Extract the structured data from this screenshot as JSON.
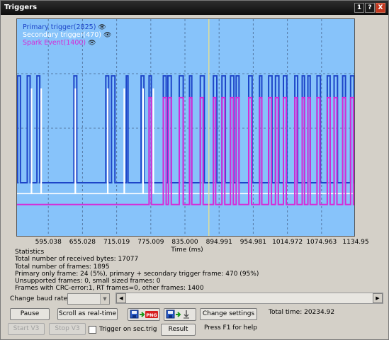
{
  "window": {
    "title": "Triggers",
    "buttons": [
      "1",
      "?",
      "X"
    ]
  },
  "chart_data": {
    "type": "line",
    "xlabel": "Time (ms)",
    "x_ticks": [
      "595.038",
      "655.028",
      "715.019",
      "775.009",
      "835.000",
      "894.991",
      "954.981",
      "1014.972",
      "1074.963",
      "1134.95"
    ],
    "x_tick_values": [
      595.038,
      655.028,
      715.019,
      775.009,
      835.0,
      894.991,
      954.981,
      1014.972,
      1074.963,
      1134.95
    ],
    "xlim": [
      540.0,
      1134.95
    ],
    "cursor_x": 877.0,
    "grid": true,
    "legend_placement": "top-left",
    "series": [
      {
        "name": "Primary trigger(2825)",
        "color": "#1d45c8",
        "baseline": 0.25,
        "high": 0.74,
        "pulses": [
          [
            541,
            546
          ],
          [
            558,
            563
          ],
          [
            575,
            580
          ],
          [
            640,
            645
          ],
          [
            696,
            701
          ],
          [
            706,
            712
          ],
          [
            732,
            735
          ],
          [
            758,
            763
          ],
          [
            772,
            776
          ],
          [
            797,
            802
          ],
          [
            805,
            811
          ],
          [
            825,
            832
          ],
          [
            843,
            847
          ],
          [
            862,
            869
          ],
          [
            885,
            891
          ],
          [
            900,
            906
          ],
          [
            915,
            921
          ],
          [
            925,
            930
          ],
          [
            947,
            953
          ],
          [
            966,
            970
          ],
          [
            982,
            988
          ],
          [
            994,
            1000
          ],
          [
            1008,
            1014
          ],
          [
            1028,
            1033
          ],
          [
            1041,
            1045
          ],
          [
            1051,
            1055
          ],
          [
            1067,
            1073
          ],
          [
            1085,
            1090
          ],
          [
            1097,
            1103
          ],
          [
            1112,
            1117
          ],
          [
            1126,
            1132
          ]
        ]
      },
      {
        "name": "Secondary trigger(470)",
        "color": "#ffffff",
        "baseline": 0.2,
        "high": 0.68,
        "pulses": [
          565,
          582,
          642,
          699,
          728,
          761,
          779
        ]
      },
      {
        "name": "Spark Event(1400)",
        "color": "#d62ad6",
        "baseline": 0.15,
        "high": 0.64,
        "pulses": [
          [
            772,
            776
          ],
          [
            797,
            802
          ],
          [
            806,
            811
          ],
          [
            825,
            832
          ],
          [
            843,
            847
          ],
          [
            862,
            867
          ],
          [
            885,
            889
          ],
          [
            900,
            905
          ],
          [
            915,
            920
          ],
          [
            925,
            930
          ],
          [
            947,
            952
          ],
          [
            966,
            970
          ],
          [
            982,
            987
          ],
          [
            994,
            999
          ],
          [
            1008,
            1013
          ],
          [
            1028,
            1032
          ],
          [
            1041,
            1045
          ],
          [
            1051,
            1055
          ],
          [
            1067,
            1072
          ],
          [
            1085,
            1090
          ],
          [
            1097,
            1102
          ],
          [
            1112,
            1117
          ],
          [
            1126,
            1131
          ]
        ]
      }
    ]
  },
  "legend": {
    "primary": "Primary trigger(2825)",
    "secondary": "Secondary trigger(470)",
    "spark": "Spark Event(1400)",
    "eye_glyph": "👁"
  },
  "stats": {
    "heading": "Statistics",
    "line1": "Total number of received bytes: 17077",
    "line2": "Total number of frames: 1895",
    "line3": "Primary only frame: 24 (5%), primary + secondary trigger frame: 470 (95%)",
    "line4": "Unsupported frames: 0, small sized frames: 0",
    "line5": "Frames with CRC-error:1, RT frames=0, other frames: 1400"
  },
  "controls": {
    "baud_label": "Change baud rate",
    "baud_value": "",
    "pause": "Pause",
    "scroll_realtime": "Scroll as real-time",
    "save_png_icon": "save-to-png-icon",
    "save_download_icon": "save-download-icon",
    "change_settings": "Change settings",
    "total_time": "Total time: 20234.92",
    "start_v3": "Start V3",
    "stop_v3": "Stop V3",
    "trigger_on_sec": "Trigger on sec.trig",
    "result": "Result",
    "help": "Press F1 for help"
  }
}
